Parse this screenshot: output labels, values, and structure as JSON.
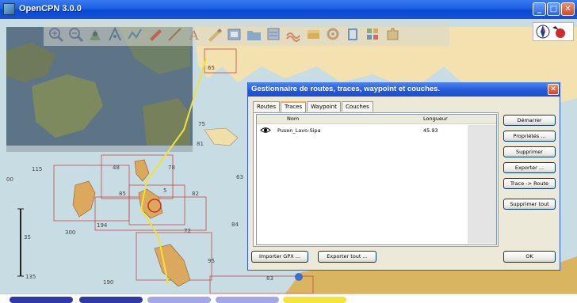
{
  "window": {
    "title": "OpenCPN 3.0.0",
    "minimize_glyph": "_",
    "maximize_glyph": "□",
    "close_glyph": "✕"
  },
  "toolbar": {
    "tools": [
      {
        "name": "zoom-in-icon"
      },
      {
        "name": "zoom-out-icon"
      },
      {
        "name": "scale-icon"
      },
      {
        "name": "route-icon"
      },
      {
        "name": "track-icon"
      },
      {
        "name": "ship-icon"
      },
      {
        "name": "measure-icon"
      },
      {
        "name": "text-icon"
      },
      {
        "name": "pencil-icon"
      },
      {
        "name": "chart-quilt-icon"
      },
      {
        "name": "folder-icon"
      },
      {
        "name": "layers-icon"
      },
      {
        "name": "tide-icon"
      },
      {
        "name": "current-icon"
      },
      {
        "name": "settings-icon"
      },
      {
        "name": "book-icon"
      },
      {
        "name": "grid-icon"
      },
      {
        "name": "puzzle-icon"
      }
    ]
  },
  "dialog": {
    "title": "Gestionnaire de routes, traces, waypoint et couches.",
    "tabs": [
      "Routes",
      "Traces",
      "Waypoint",
      "Couches"
    ],
    "active_tab": "Traces",
    "columns": {
      "name": "Nom",
      "length": "Longueur"
    },
    "rows": [
      {
        "name": "Pusen_Lavo-Sipa",
        "length": "45.93"
      }
    ],
    "side_buttons": [
      "Démarrer",
      "Propriétés ...",
      "Supprimer",
      "Exporter ...",
      "Trace -> Route",
      "Supprimer tout"
    ],
    "bottom_buttons": {
      "import": "Importer GPX ...",
      "export_all": "Exporter tout ...",
      "ok": "OK"
    },
    "close_glyph": "✕"
  },
  "chart": {
    "labels": [
      "115",
      "00",
      "48",
      "78",
      "63",
      "81",
      "85",
      "5",
      "82",
      "194",
      "72",
      "300",
      "84",
      "35",
      "95",
      "135",
      "190",
      "83",
      "75",
      "65"
    ]
  },
  "taskbar": {
    "items": [
      {
        "color": "#2e3aa8"
      },
      {
        "color": "#2e3aa8"
      },
      {
        "color": "#a5a6e8"
      },
      {
        "color": "#a5a6e8"
      },
      {
        "color": "#f4e53a"
      }
    ]
  }
}
